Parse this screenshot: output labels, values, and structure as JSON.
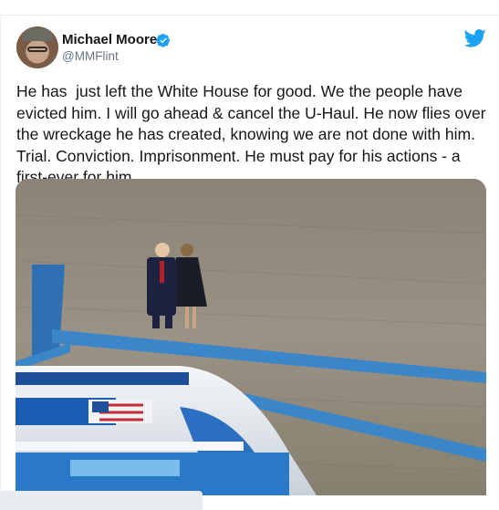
{
  "tweet": {
    "display_name": "Michael Moore",
    "handle": "@MMFlint",
    "text": "He has  just left the White House for good. We the people have evicted him. I will go ahead & cancel the U-Haul. He now flies over the wreckage he has created, knowing we are not done with him. Trial. Conviction. Imprisonment. He must pay for his actions - a first-ever for him.",
    "verified_icon": "verified-badge-icon",
    "brand_icon": "twitter-bird-icon"
  },
  "colors": {
    "twitter_blue": "#1da1f2",
    "name": "#14171a",
    "handle": "#657786"
  }
}
